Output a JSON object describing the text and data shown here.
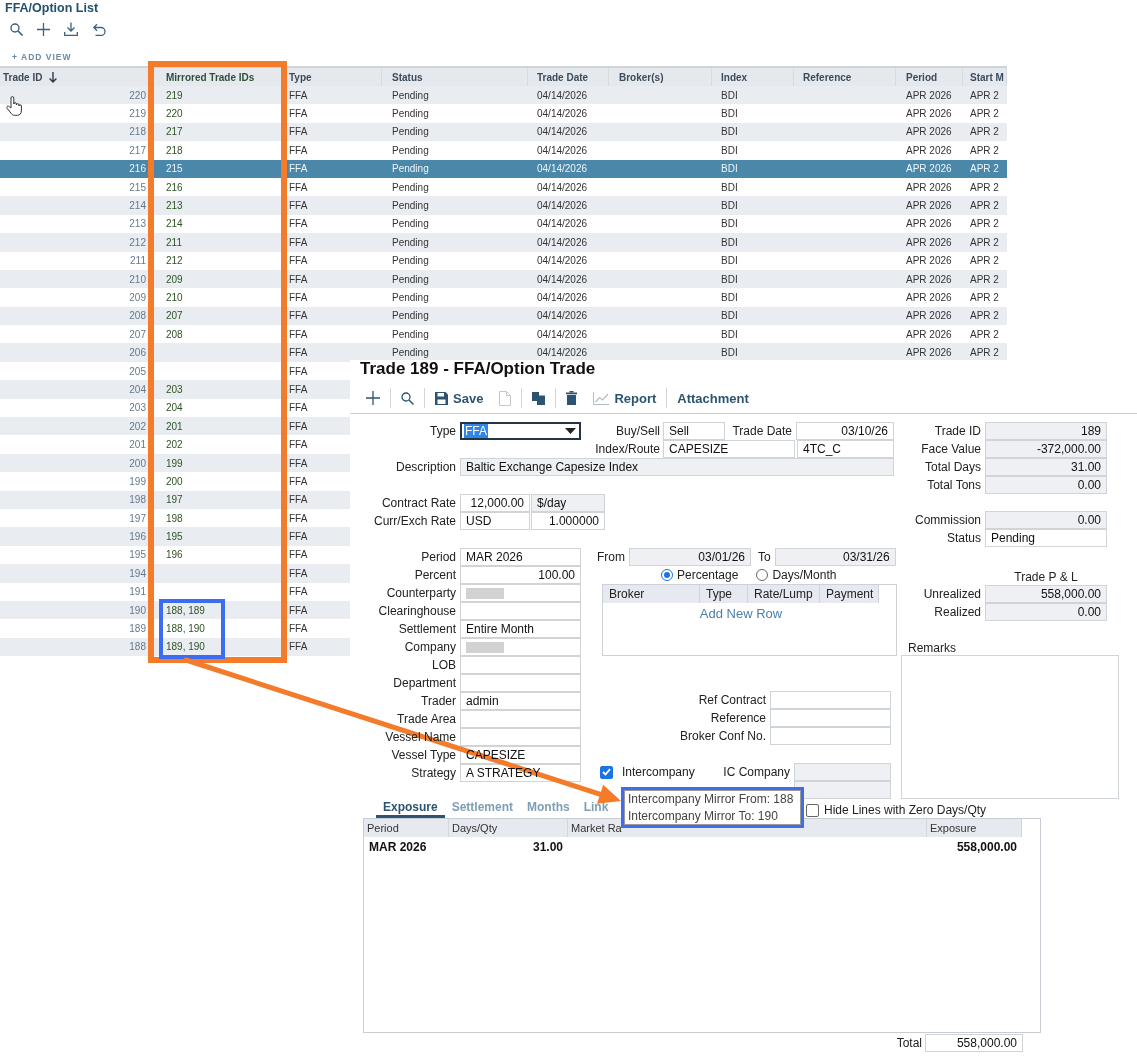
{
  "list": {
    "title": "FFA/Option List",
    "add_view": "+ ADD VIEW",
    "columns": [
      {
        "label": "Trade ID",
        "sorted": true
      },
      {
        "label": "Mirrored Trade IDs",
        "sorted": false
      },
      {
        "label": "Type",
        "sorted": false
      },
      {
        "label": "Status",
        "sorted": false
      },
      {
        "label": "Trade Date",
        "sorted": false
      },
      {
        "label": "Broker(s)",
        "sorted": false
      },
      {
        "label": "Index",
        "sorted": false
      },
      {
        "label": "Reference",
        "sorted": false
      },
      {
        "label": "Period",
        "sorted": false
      },
      {
        "label": "Start M",
        "sorted": false
      }
    ],
    "rows": [
      {
        "trade_id": "220",
        "mirrored_trade_ids": "219",
        "type": "FFA",
        "status": "Pending",
        "trade_date": "04/14/2026",
        "index": "BDI",
        "period": "APR 2026",
        "column_10": "APR 2",
        "selected": false
      },
      {
        "trade_id": "219",
        "mirrored_trade_ids": "220",
        "type": "FFA",
        "status": "Pending",
        "trade_date": "04/14/2026",
        "index": "BDI",
        "period": "APR 2026",
        "column_10": "APR 2",
        "selected": false
      },
      {
        "trade_id": "218",
        "mirrored_trade_ids": "217",
        "type": "FFA",
        "status": "Pending",
        "trade_date": "04/14/2026",
        "index": "BDI",
        "period": "APR 2026",
        "column_10": "APR 2",
        "selected": false
      },
      {
        "trade_id": "217",
        "mirrored_trade_ids": "218",
        "type": "FFA",
        "status": "Pending",
        "trade_date": "04/14/2026",
        "index": "BDI",
        "period": "APR 2026",
        "column_10": "APR 2",
        "selected": false
      },
      {
        "trade_id": "216",
        "mirrored_trade_ids": "215",
        "type": "FFA",
        "status": "Pending",
        "trade_date": "04/14/2026",
        "index": "BDI",
        "period": "APR 2026",
        "column_10": "APR 2",
        "selected": true
      },
      {
        "trade_id": "215",
        "mirrored_trade_ids": "216",
        "type": "FFA",
        "status": "Pending",
        "trade_date": "04/14/2026",
        "index": "BDI",
        "period": "APR 2026",
        "column_10": "APR 2",
        "selected": false
      },
      {
        "trade_id": "214",
        "mirrored_trade_ids": "213",
        "type": "FFA",
        "status": "Pending",
        "trade_date": "04/14/2026",
        "index": "BDI",
        "period": "APR 2026",
        "column_10": "APR 2",
        "selected": false
      },
      {
        "trade_id": "213",
        "mirrored_trade_ids": "214",
        "type": "FFA",
        "status": "Pending",
        "trade_date": "04/14/2026",
        "index": "BDI",
        "period": "APR 2026",
        "column_10": "APR 2",
        "selected": false
      },
      {
        "trade_id": "212",
        "mirrored_trade_ids": "211",
        "type": "FFA",
        "status": "Pending",
        "trade_date": "04/14/2026",
        "index": "BDI",
        "period": "APR 2026",
        "column_10": "APR 2",
        "selected": false
      },
      {
        "trade_id": "211",
        "mirrored_trade_ids": "212",
        "type": "FFA",
        "status": "Pending",
        "trade_date": "04/14/2026",
        "index": "BDI",
        "period": "APR 2026",
        "column_10": "APR 2",
        "selected": false
      },
      {
        "trade_id": "210",
        "mirrored_trade_ids": "209",
        "type": "FFA",
        "status": "Pending",
        "trade_date": "04/14/2026",
        "index": "BDI",
        "period": "APR 2026",
        "column_10": "APR 2",
        "selected": false
      },
      {
        "trade_id": "209",
        "mirrored_trade_ids": "210",
        "type": "FFA",
        "status": "Pending",
        "trade_date": "04/14/2026",
        "index": "BDI",
        "period": "APR 2026",
        "column_10": "APR 2",
        "selected": false
      },
      {
        "trade_id": "208",
        "mirrored_trade_ids": "207",
        "type": "FFA",
        "status": "Pending",
        "trade_date": "04/14/2026",
        "index": "BDI",
        "period": "APR 2026",
        "column_10": "APR 2",
        "selected": false
      },
      {
        "trade_id": "207",
        "mirrored_trade_ids": "208",
        "type": "FFA",
        "status": "Pending",
        "trade_date": "04/14/2026",
        "index": "BDI",
        "period": "APR 2026",
        "column_10": "APR 2",
        "selected": false
      },
      {
        "trade_id": "206",
        "type": "FFA",
        "status": "Pending",
        "trade_date": "04/14/2026",
        "index": "BDI",
        "period": "APR 2026",
        "column_10": "APR 2",
        "selected": false
      },
      {
        "trade_id": "205",
        "type": "FFA",
        "selected": false
      },
      {
        "trade_id": "204",
        "mirrored_trade_ids": "203",
        "type": "FFA",
        "selected": false
      },
      {
        "trade_id": "203",
        "mirrored_trade_ids": "204",
        "type": "FFA",
        "selected": false
      },
      {
        "trade_id": "202",
        "mirrored_trade_ids": "201",
        "type": "FFA",
        "selected": false
      },
      {
        "trade_id": "201",
        "mirrored_trade_ids": "202",
        "type": "FFA",
        "selected": false
      },
      {
        "trade_id": "200",
        "mirrored_trade_ids": "199",
        "type": "FFA",
        "selected": false
      },
      {
        "trade_id": "199",
        "mirrored_trade_ids": "200",
        "type": "FFA",
        "selected": false
      },
      {
        "trade_id": "198",
        "mirrored_trade_ids": "197",
        "type": "FFA",
        "selected": false
      },
      {
        "trade_id": "197",
        "mirrored_trade_ids": "198",
        "type": "FFA",
        "selected": false
      },
      {
        "trade_id": "196",
        "mirrored_trade_ids": "195",
        "type": "FFA",
        "selected": false
      },
      {
        "trade_id": "195",
        "mirrored_trade_ids": "196",
        "type": "FFA",
        "selected": false
      },
      {
        "trade_id": "194",
        "type": "FFA",
        "selected": false
      },
      {
        "trade_id": "191",
        "type": "FFA",
        "selected": false
      },
      {
        "trade_id": "190",
        "mirrored_trade_ids": "188, 189",
        "type": "FFA",
        "selected": false
      },
      {
        "trade_id": "189",
        "mirrored_trade_ids": "188, 190",
        "type": "FFA",
        "selected": false
      },
      {
        "trade_id": "188",
        "mirrored_trade_ids": "189, 190",
        "type": "FFA",
        "selected": false
      }
    ]
  },
  "trade_window": {
    "title": "Trade 189 - FFA/Option Trade",
    "toolbar": [
      {
        "kind": "add",
        "separated": false,
        "disabled": false
      },
      {
        "kind": "search",
        "separated": true,
        "disabled": false
      },
      {
        "kind": "save",
        "label": "Save",
        "separated": true,
        "disabled": false
      },
      {
        "kind": "document",
        "separated": false,
        "disabled": true
      },
      {
        "kind": "copy",
        "separated": true,
        "disabled": false
      },
      {
        "kind": "delete",
        "separated": true,
        "disabled": false
      },
      {
        "kind": "report",
        "label": "Report",
        "separated": false,
        "disabled": false
      },
      {
        "kind": "attachment",
        "label": "Attachment",
        "separated": true,
        "disabled": false
      }
    ],
    "type": {
      "label": "Type",
      "value": "FFA"
    },
    "buy_sell": {
      "label": "Buy/Sell",
      "value": "Sell"
    },
    "trade_date": {
      "label": "Trade Date",
      "value": "03/10/26"
    },
    "index_route": {
      "label": "Index/Route",
      "inputs": [
        {
          "value": "CAPESIZE",
          "readonly": false
        },
        {
          "value": "4TC_C",
          "readonly": false
        }
      ]
    },
    "description": {
      "label": "Description",
      "value": "Baltic Exchange Capesize Index",
      "readonly": true
    },
    "rates": [
      {
        "label": "Contract Rate",
        "inputs": [
          {
            "value": "12,000.00",
            "kind": "number",
            "readonly": false
          },
          {
            "value": "$/day",
            "kind": "text",
            "readonly": true
          }
        ]
      },
      {
        "label": "Curr/Exch Rate",
        "inputs": [
          {
            "value": "USD",
            "kind": "text",
            "readonly": false
          },
          {
            "value": "1.000000",
            "kind": "number",
            "readonly": false
          }
        ]
      }
    ],
    "details": [
      {
        "label": "Period",
        "value": "MAR 2026",
        "kind": "text"
      },
      {
        "label": "Percent",
        "value": "100.00",
        "kind": "number"
      },
      {
        "label": "Counterparty",
        "kind": "redacted"
      },
      {
        "label": "Clearinghouse"
      },
      {
        "label": "Settlement",
        "value": "Entire Month",
        "kind": "text"
      },
      {
        "label": "Company",
        "kind": "redacted"
      },
      {
        "label": "LOB"
      },
      {
        "label": "Department"
      },
      {
        "label": "Trader",
        "value": "admin",
        "kind": "text"
      },
      {
        "label": "Trade Area"
      },
      {
        "label": "Vessel Name"
      },
      {
        "label": "Vessel Type",
        "value": "CAPESIZE",
        "kind": "text"
      },
      {
        "label": "Strategy",
        "value": "A STRATEGY",
        "kind": "text"
      }
    ],
    "date_range": [
      {
        "label": "From",
        "value": "03/01/26",
        "readonly": true
      },
      {
        "label": "To",
        "value": "03/31/26",
        "readonly": true
      }
    ],
    "allocation": [
      {
        "label": "Percentage",
        "selected": true
      },
      {
        "label": "Days/Month",
        "selected": false
      }
    ],
    "broker_grid": {
      "columns": [
        "Broker",
        "Type",
        "Rate/Lump",
        "Payment"
      ],
      "add_row": "Add New Row"
    },
    "references": [
      {
        "label": "Ref Contract"
      },
      {
        "label": "Reference"
      },
      {
        "label": "Broker Conf No."
      }
    ],
    "intercompany": {
      "label": "Intercompany",
      "checked": true
    },
    "ic_company": {
      "label": "IC Company",
      "readonly": true
    },
    "summary": [
      {
        "label": "Trade ID",
        "value": "189",
        "readonly": true
      },
      {
        "label": "Face Value",
        "value": "-372,000.00",
        "readonly": true
      },
      {
        "label": "Total Days",
        "value": "31.00",
        "readonly": true
      },
      {
        "label": "Total Tons",
        "value": "0.00",
        "readonly": true
      }
    ],
    "status_fields": [
      {
        "label": "Commission",
        "value": "0.00",
        "kind": "number",
        "readonly": true
      },
      {
        "label": "Status",
        "value": "Pending",
        "kind": "text",
        "readonly": false
      }
    ],
    "pnl": {
      "title": "Trade P & L",
      "fields": [
        {
          "label": "Unrealized",
          "value": "558,000.00",
          "readonly": true
        },
        {
          "label": "Realized",
          "value": "0.00",
          "readonly": true
        }
      ]
    },
    "remarks": {
      "label": "Remarks"
    },
    "tabs": [
      {
        "label": "Exposure",
        "selected": true
      },
      {
        "label": "Settlement",
        "selected": false
      },
      {
        "label": "Months",
        "selected": false
      },
      {
        "label": "Link",
        "selected": false
      }
    ],
    "hide_zero_lines": {
      "label": "Hide Lines with Zero Days/Qty",
      "checked": false
    },
    "exposure": {
      "columns": [
        "Period",
        "Days/Qty",
        "Market Ra",
        "Exposure"
      ],
      "rows": [
        {
          "period": "MAR 2026",
          "days_qty": "31.00",
          "exposure": "558,000.00"
        }
      ],
      "total": {
        "label": "Total",
        "value": "558,000.00"
      }
    },
    "tooltip": {
      "lines": [
        "Intercompany Mirror From: 188",
        "Intercompany Mirror To: 190"
      ]
    }
  }
}
